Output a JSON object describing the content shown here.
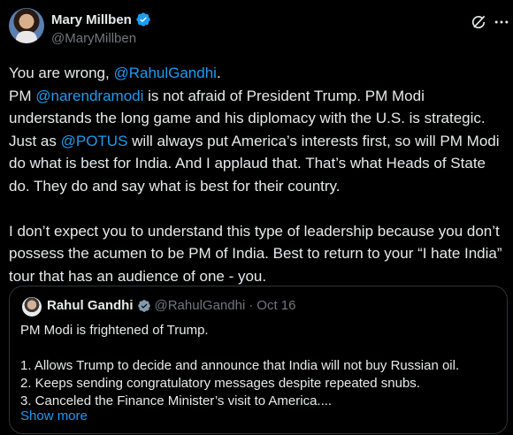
{
  "author": {
    "display_name": "Mary Millben",
    "handle": "@MaryMillben"
  },
  "post": {
    "line1_prefix": "You are wrong, ",
    "line1_mention": "@RahulGandhi",
    "line1_suffix": ".",
    "p2_a": "PM ",
    "p2_mention1": "@narendramodi",
    "p2_b": " is not afraid of President Trump. PM Modi understands the long game and his diplomacy with the U.S. is strategic. Just as ",
    "p2_mention2": "@POTUS",
    "p2_c": " will always put America’s interests first, so will PM Modi do what is best for India. And I applaud that. That’s what Heads of State do. They do and say what is best for their country.",
    "p3": "I don’t expect you to understand this type of leadership because you don’t possess the acumen to be PM of India. Best to return to your “I hate India” tour that has an audience of one - you."
  },
  "quoted": {
    "display_name": "Rahul Gandhi",
    "handle": "@RahulGandhi",
    "separator": "·",
    "date": "Oct 16",
    "line1": "PM Modi is frightened of Trump.",
    "item1": "1. Allows Trump to decide and announce that India will not buy Russian oil.",
    "item2": "2. Keeps sending congratulatory messages despite repeated snubs.",
    "item3": "3. Canceled the Finance Minister’s visit to America....",
    "show_more": "Show more"
  },
  "colors": {
    "background": "#000000",
    "text": "#e7e9ea",
    "secondary": "#71767b",
    "link": "#1d9bf0",
    "border": "#2f3336"
  }
}
